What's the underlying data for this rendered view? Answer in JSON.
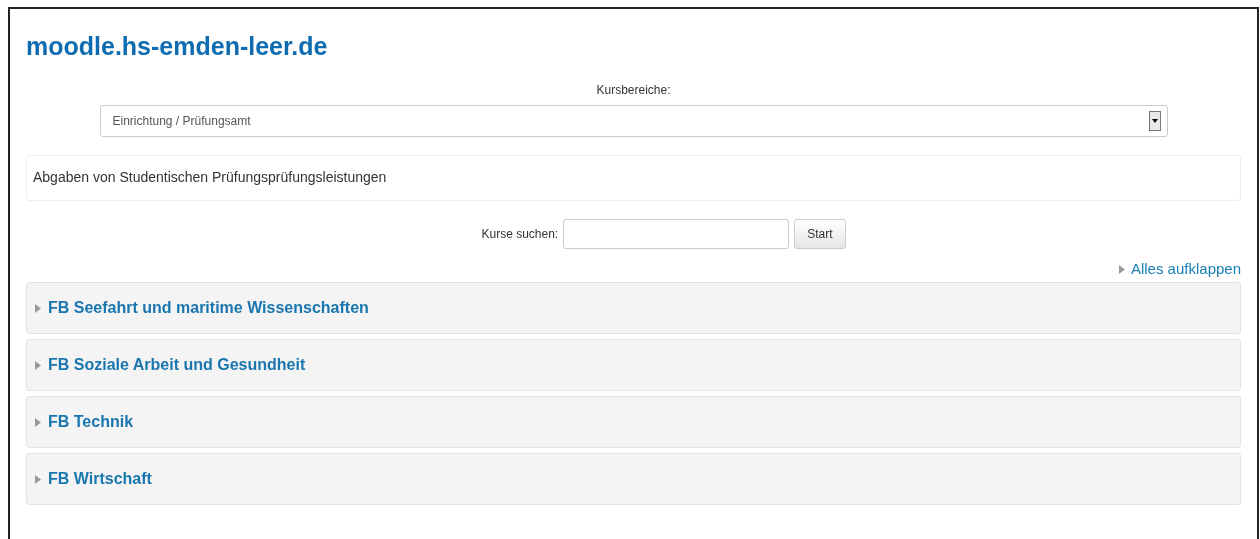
{
  "site_title": "moodle.hs-emden-leer.de",
  "category_select": {
    "label": "Kursbereiche:",
    "value": "Einrichtung / Prüfungsamt"
  },
  "description": "Abgaben von Studentischen Prüfungsprüfungsleistungen",
  "search": {
    "label": "Kurse suchen:",
    "button": "Start"
  },
  "expand_all": "Alles aufklappen",
  "categories": [
    {
      "name": "FB Seefahrt und maritime Wissenschaften",
      "expanded": false
    },
    {
      "name": "FB Soziale Arbeit und Gesundheit",
      "expanded": false
    },
    {
      "name": "FB Technik",
      "expanded": false
    },
    {
      "name": "FB Wirtschaft",
      "expanded": false
    }
  ]
}
